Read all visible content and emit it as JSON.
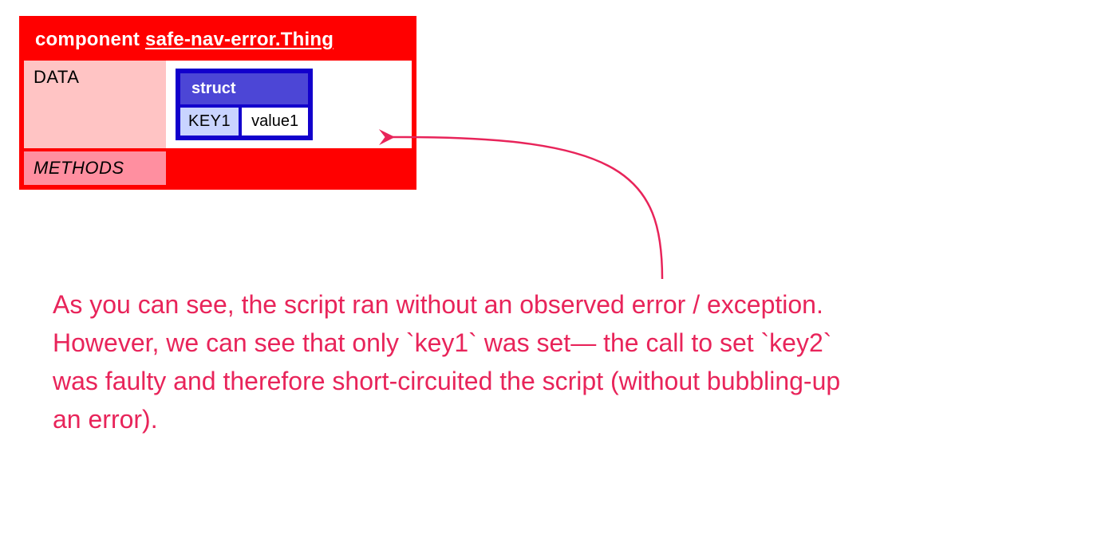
{
  "colors": {
    "red": "#ff0000",
    "blue": "#1200cc",
    "annotation": "#e8245a"
  },
  "component": {
    "keyword": "component",
    "name": "safe-nav-error.Thing",
    "rows": {
      "data_label": "DATA",
      "methods_label": "METHODS"
    },
    "struct": {
      "header": "struct",
      "entries": [
        {
          "key": "KEY1",
          "value": "value1"
        }
      ]
    }
  },
  "note_parts": {
    "p1": "As you can see, the script ran without an observed error / exception. However, we can see that only ",
    "code1": "`key1`",
    "p2": " was set— the call to set ",
    "code2": "`key2`",
    "p3": " was faulty and therefore short-circuited the script (without bubbling-up an error)."
  }
}
